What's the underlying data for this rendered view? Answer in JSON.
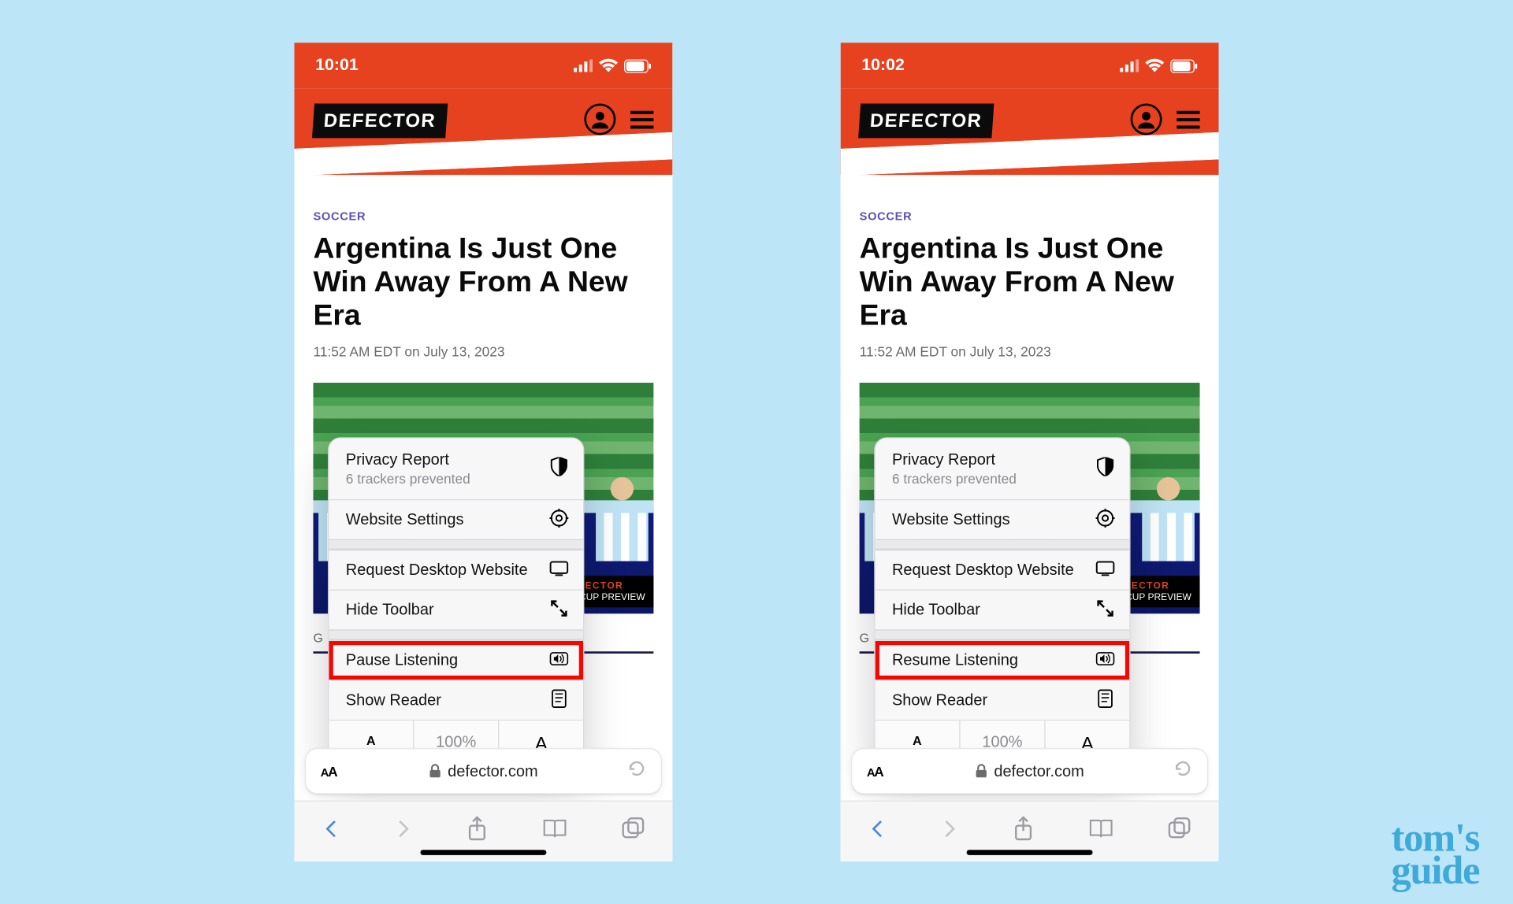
{
  "watermark": {
    "line1": "tom's",
    "line2": "guide"
  },
  "screens": [
    {
      "status_time": "10:01",
      "site_logo": "DEFECTOR",
      "category": "SOCCER",
      "headline": "Argentina Is Just One Win Away From A New Era",
      "meta": "11:52 AM EDT on July 13, 2023",
      "hero_badge_top": "DEFECTOR",
      "hero_badge_sub": "WORLD CUP PREVIEW",
      "truncated_g": "G",
      "popover": {
        "privacy_title": "Privacy Report",
        "privacy_sub": "6 trackers prevented",
        "website_settings": "Website Settings",
        "request_desktop": "Request Desktop Website",
        "hide_toolbar": "Hide Toolbar",
        "listen": "Pause Listening",
        "show_reader": "Show Reader",
        "zoom": "100%"
      },
      "url": "defector.com"
    },
    {
      "status_time": "10:02",
      "site_logo": "DEFECTOR",
      "category": "SOCCER",
      "headline": "Argentina Is Just One Win Away From A New Era",
      "meta": "11:52 AM EDT on July 13, 2023",
      "hero_badge_top": "DEFECTOR",
      "hero_badge_sub": "WORLD CUP PREVIEW",
      "truncated_g": "G",
      "popover": {
        "privacy_title": "Privacy Report",
        "privacy_sub": "6 trackers prevented",
        "website_settings": "Website Settings",
        "request_desktop": "Request Desktop Website",
        "hide_toolbar": "Hide Toolbar",
        "listen": "Resume Listening",
        "show_reader": "Show Reader",
        "zoom": "100%"
      },
      "url": "defector.com"
    }
  ]
}
